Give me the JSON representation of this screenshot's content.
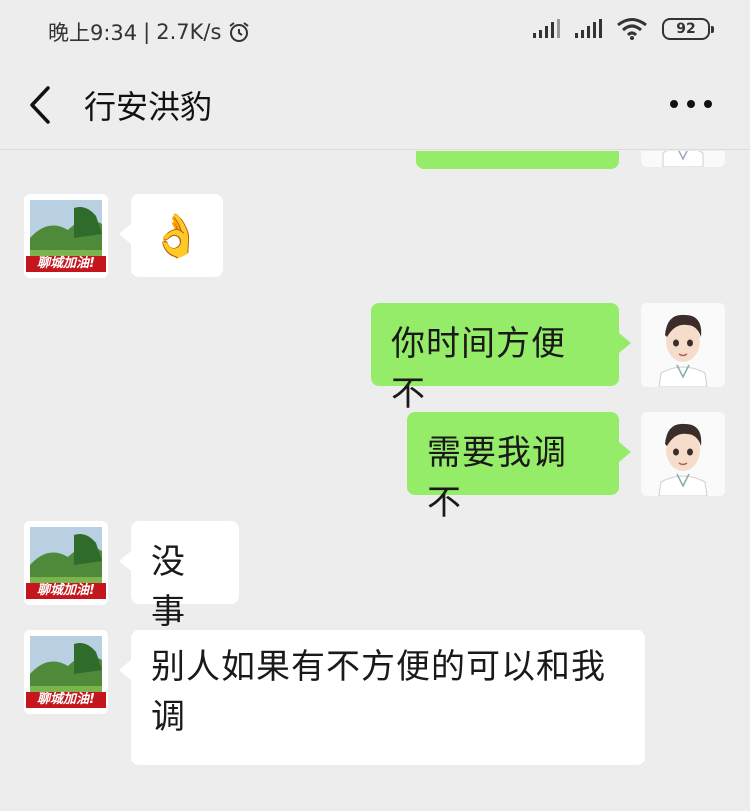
{
  "status_bar": {
    "time": "晚上9:34",
    "network_speed": "2.7K/s",
    "battery_level": "92",
    "icons": [
      "alarm-icon",
      "signal-icon",
      "signal-icon",
      "wifi-icon",
      "battery-icon"
    ]
  },
  "header": {
    "title": "行安洪豹",
    "back_icon": "chevron-left-icon",
    "more_icon": "more-dots-icon"
  },
  "colors": {
    "background": "#ededed",
    "my_bubble": "#95ec69",
    "other_bubble": "#ffffff"
  },
  "messages": [
    {
      "from": "me",
      "type": "text",
      "text": ""
    },
    {
      "from": "other",
      "type": "emoji",
      "emoji": "👌"
    },
    {
      "from": "me",
      "type": "text",
      "text": "你时间方便不"
    },
    {
      "from": "me",
      "type": "text",
      "text": "需要我调不"
    },
    {
      "from": "other",
      "type": "text",
      "text": "没事"
    },
    {
      "from": "other",
      "type": "text",
      "text": "别人如果有不方便的可以和我调"
    }
  ],
  "contact_avatar": {
    "caption": "聊城加油!"
  }
}
